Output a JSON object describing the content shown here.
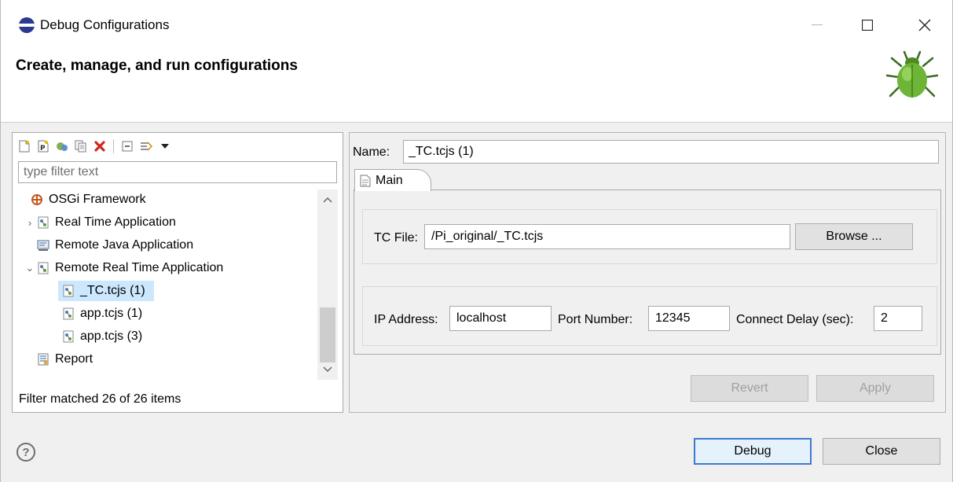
{
  "window": {
    "title": "Debug Configurations",
    "header_title": "Create, manage, and run configurations"
  },
  "sidebar": {
    "filter_placeholder": "type filter text",
    "filter_status": "Filter matched 26 of 26 items",
    "tree": [
      {
        "label": "OSGi Framework",
        "icon": "osgi-icon",
        "expanded": null
      },
      {
        "label": "Real Time Application",
        "icon": "realtime-app-icon",
        "expanded": false
      },
      {
        "label": "Remote Java Application",
        "icon": "remote-java-icon",
        "expanded": null
      },
      {
        "label": "Remote Real Time Application",
        "icon": "realtime-app-icon",
        "expanded": true
      },
      {
        "label": "_TC.tcjs (1)",
        "icon": "config-icon",
        "selected": true
      },
      {
        "label": "app.tcjs (1)",
        "icon": "config-icon"
      },
      {
        "label": "app.tcjs (3)",
        "icon": "config-icon"
      },
      {
        "label": "Report",
        "icon": "report-icon",
        "expanded": null
      }
    ]
  },
  "main": {
    "name_label": "Name:",
    "name_value": "_TC.tcjs (1)",
    "tab_label": "Main",
    "tc_file_label": "TC File:",
    "tc_file_value": "/Pi_original/_TC.tcjs",
    "browse_label": "Browse ...",
    "ip_label": "IP Address:",
    "ip_value": "localhost",
    "port_label": "Port Number:",
    "port_value": "12345",
    "delay_label": "Connect Delay (sec):",
    "delay_value": "2",
    "revert_label": "Revert",
    "apply_label": "Apply"
  },
  "footer": {
    "debug_label": "Debug",
    "close_label": "Close"
  },
  "colors": {
    "selection": "#cce8ff",
    "primary_border": "#3d7bd1"
  }
}
